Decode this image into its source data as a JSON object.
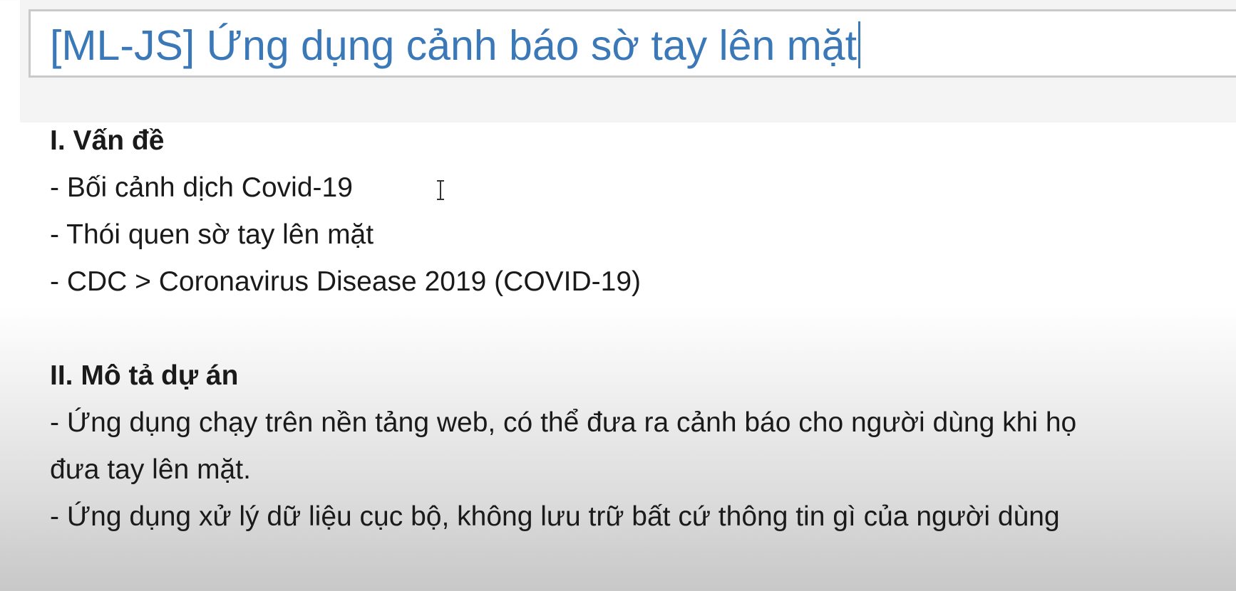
{
  "title_field": {
    "value": "[ML-JS] Ứng dụng cảnh báo sờ tay lên mặt"
  },
  "section1": {
    "heading": "I. Vấn đề",
    "items": [
      "- Bối cảnh dịch Covid-19",
      "- Thói quen sờ tay lên mặt",
      "- CDC > Coronavirus Disease 2019 (COVID-19)"
    ]
  },
  "section2": {
    "heading": "II. Mô tả dự án",
    "items": [
      "- Ứng dụng chạy trên nền tảng web, có thể đưa ra cảnh báo cho người dùng khi họ",
      "đưa tay lên mặt.",
      "- Ứng dụng xử lý dữ liệu cục bộ, không lưu trữ bất cứ thông tin gì của người dùng"
    ]
  },
  "colors": {
    "title_text": "#3b78b8",
    "title_border": "#c9c9c9",
    "body_text": "#1a1a1a"
  },
  "icons": {
    "cursor": "text-cursor-icon"
  }
}
